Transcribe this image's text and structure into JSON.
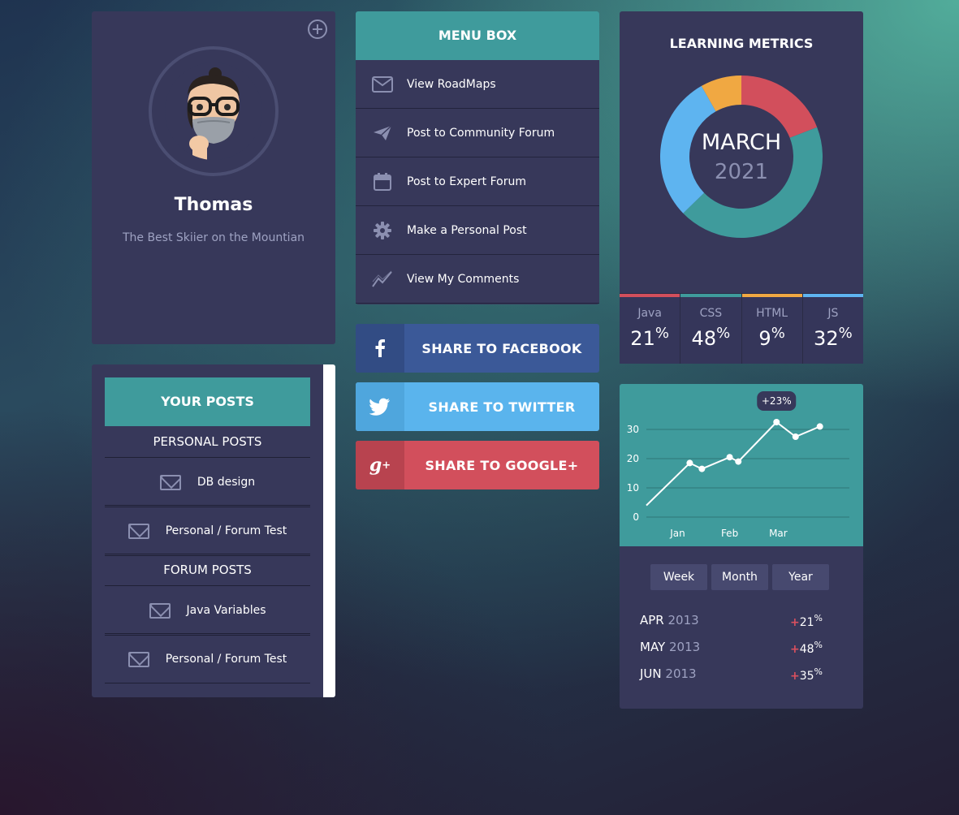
{
  "profile": {
    "name": "Thomas",
    "tagline": "The Best Skiier on the Mountian"
  },
  "posts": {
    "header": "YOUR POSTS",
    "personal_section": "PERSONAL POSTS",
    "forum_section": "FORUM POSTS",
    "personal_items": [
      "DB design",
      "Personal / Forum Test"
    ],
    "forum_items": [
      "Java Variables",
      "Personal / Forum Test"
    ]
  },
  "menu": {
    "title": "MENU BOX",
    "items": [
      {
        "label": "View RoadMaps",
        "icon": "envelope-icon"
      },
      {
        "label": "Post to Community Forum",
        "icon": "paper-plane-icon"
      },
      {
        "label": "Post to Expert Forum",
        "icon": "calendar-icon"
      },
      {
        "label": "Make a Personal Post",
        "icon": "gear-icon"
      },
      {
        "label": "View My Comments",
        "icon": "line-chart-icon"
      }
    ]
  },
  "share": {
    "facebook": "SHARE TO FACEBOOK",
    "twitter": "SHARE TO TWITTER",
    "google": "SHARE TO GOOGLE+",
    "facebook_color": "#3b5998",
    "twitter_color": "#5ab4ed",
    "google_color": "#d24f5c"
  },
  "metrics": {
    "title": "LEARNING METRICS",
    "month": "MARCH",
    "year": "2021",
    "stats": [
      {
        "name": "Java",
        "value": "21",
        "unit": "%",
        "color": "#d24f5c",
        "share": 21
      },
      {
        "name": "CSS",
        "value": "48",
        "unit": "%",
        "color": "#3f9b9c",
        "share": 48
      },
      {
        "name": "HTML",
        "value": "9",
        "unit": "%",
        "color": "#f0a842",
        "share": 9
      },
      {
        "name": "JS",
        "value": "32",
        "unit": "%",
        "color": "#5eb4f0",
        "share": 32
      }
    ]
  },
  "activity": {
    "tooltip": "+23%",
    "tabs": [
      "Week",
      "Month",
      "Year"
    ],
    "ranges": [
      {
        "month": "APR",
        "year": "2013",
        "plus": "+",
        "value": "21",
        "unit": "%"
      },
      {
        "month": "MAY",
        "year": "2013",
        "plus": "+",
        "value": "48",
        "unit": "%"
      },
      {
        "month": "JUN",
        "year": "2013",
        "plus": "+",
        "value": "35",
        "unit": "%"
      }
    ]
  },
  "chart_data": {
    "type": "line",
    "y_ticks": [
      "0",
      "10",
      "20",
      "30"
    ],
    "x_tick_labels": [
      "Jan",
      "Feb",
      "Mar"
    ],
    "ylim": [
      0,
      30
    ],
    "xlim": [
      0,
      5.85
    ],
    "x": [
      0.0,
      1.25,
      1.6,
      2.4,
      2.65,
      3.75,
      4.3,
      5.0
    ],
    "values": [
      4,
      18.5,
      16.5,
      20.5,
      19,
      32.5,
      27.5,
      31
    ],
    "x_tick_positions": [
      0.9,
      2.4,
      3.8
    ],
    "line_color": "#ffffff",
    "grid": true
  }
}
